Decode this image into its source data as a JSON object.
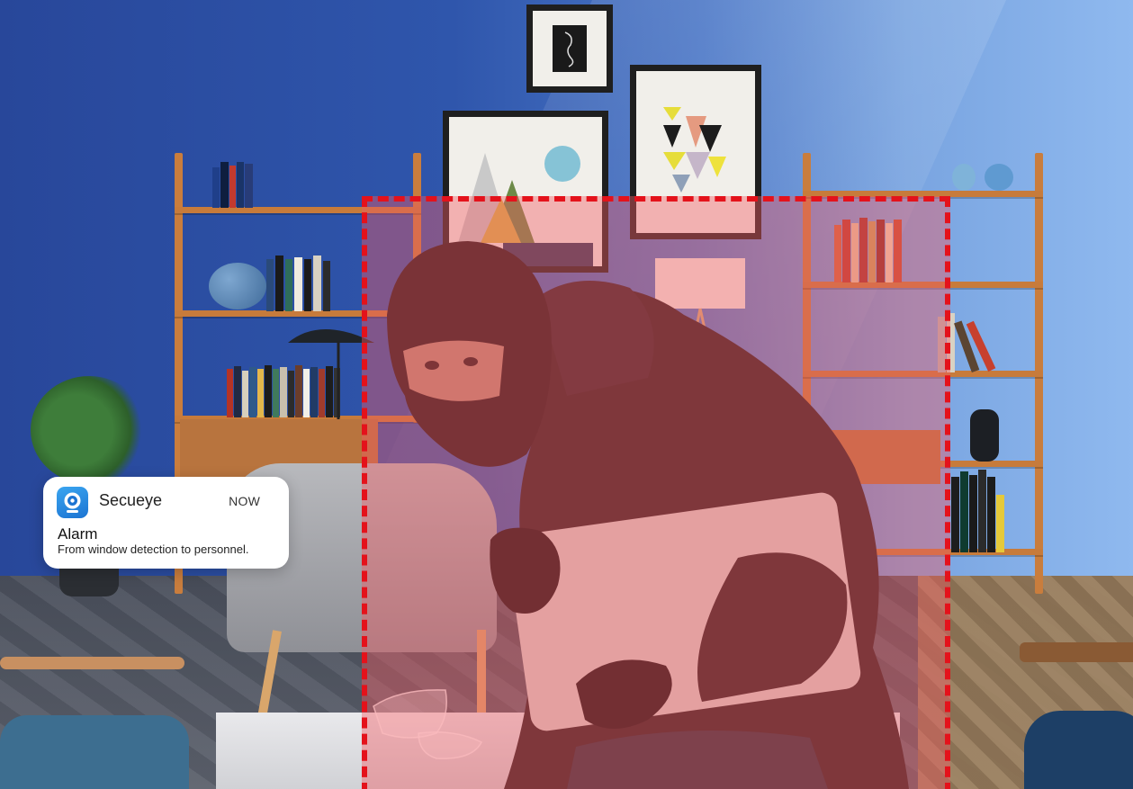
{
  "notification": {
    "app_icon": "camera-eye-icon",
    "app_name": "Secueye",
    "time": "NOW",
    "title": "Alarm",
    "body": "From window detection to personnel."
  },
  "detection_zone": {
    "border_color": "#e4121b",
    "fill_color": "#f45a62",
    "style": "dashed"
  },
  "colors": {
    "wall": "#2f56ac",
    "shelf_wood": "#c97d3d",
    "app_accent": "#1c74d2"
  }
}
